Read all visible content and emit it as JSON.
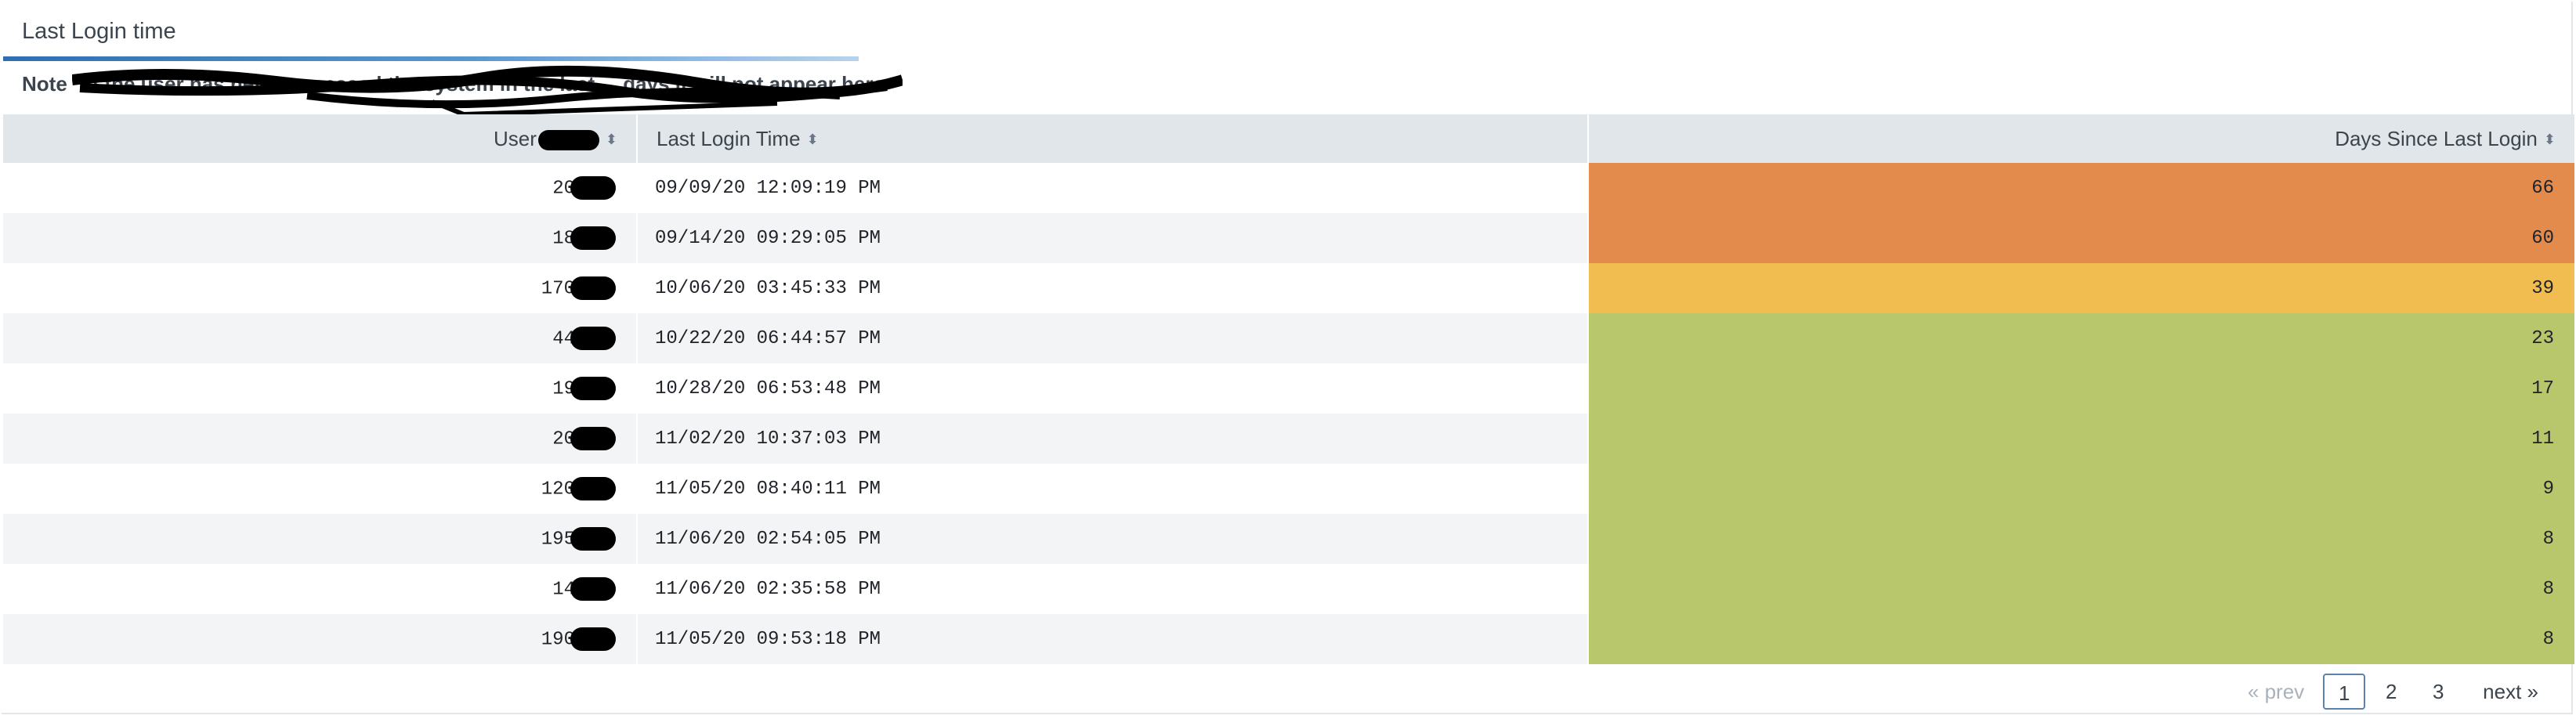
{
  "panel": {
    "title": "Last Login time",
    "note": "Note * If the user has never accessed the system in the last ... days it will not appear here"
  },
  "table": {
    "headers": {
      "user": "User",
      "time": "Last Login Time",
      "days": "Days Since Last Login"
    },
    "rows": [
      {
        "user": "20",
        "time": "09/09/20 12:09:19 PM",
        "days": "66",
        "color": "#e38a4d"
      },
      {
        "user": "18",
        "time": "09/14/20 09:29:05 PM",
        "days": "60",
        "color": "#e38a4d"
      },
      {
        "user": "170",
        "time": "10/06/20 03:45:33 PM",
        "days": "39",
        "color": "#f1bd51"
      },
      {
        "user": "44",
        "time": "10/22/20 06:44:57 PM",
        "days": "23",
        "color": "#b8c66c"
      },
      {
        "user": "19",
        "time": "10/28/20 06:53:48 PM",
        "days": "17",
        "color": "#b8c66c"
      },
      {
        "user": "20",
        "time": "11/02/20 10:37:03 PM",
        "days": "11",
        "color": "#b8c66c"
      },
      {
        "user": "120",
        "time": "11/05/20 08:40:11 PM",
        "days": "9",
        "color": "#b8c66c"
      },
      {
        "user": "195",
        "time": "11/06/20 02:54:05 PM",
        "days": "8",
        "color": "#b8c66c"
      },
      {
        "user": "14",
        "time": "11/06/20 02:35:58 PM",
        "days": "8",
        "color": "#b8c66c"
      },
      {
        "user": "190",
        "time": "11/05/20 09:53:18 PM",
        "days": "8",
        "color": "#b8c66c"
      }
    ]
  },
  "pagination": {
    "prev": "« prev",
    "pages": [
      "1",
      "2",
      "3"
    ],
    "active": "1",
    "next": "next »"
  },
  "icons": {
    "sort": "sort-icon"
  }
}
